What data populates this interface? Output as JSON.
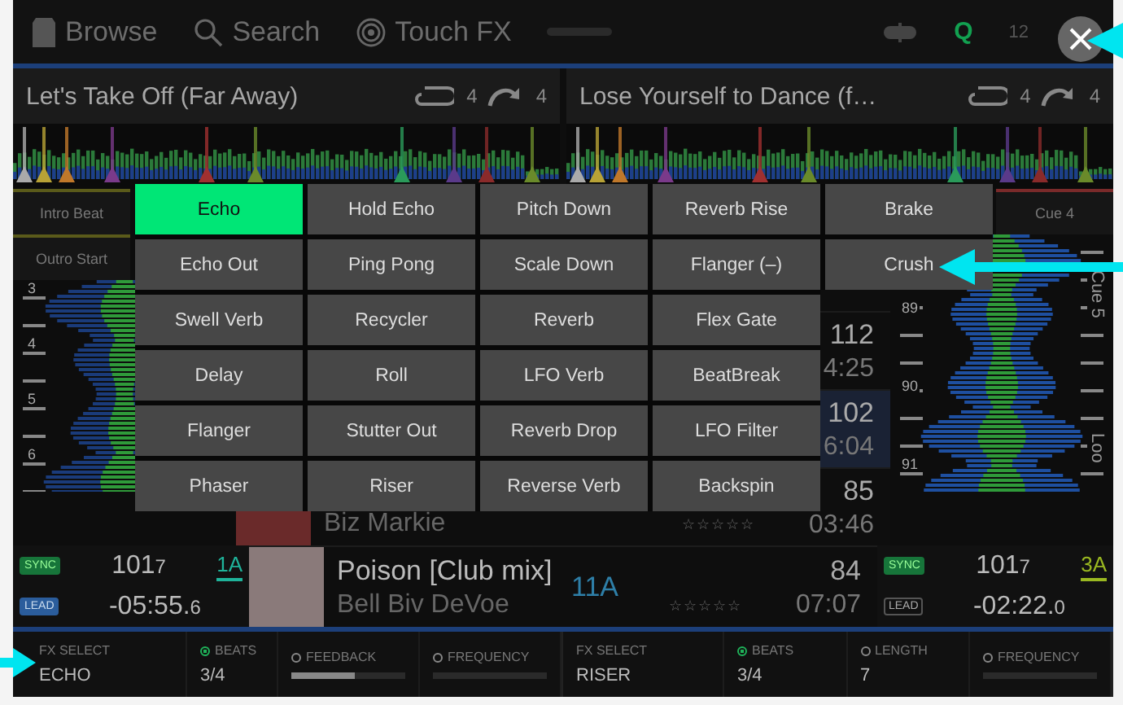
{
  "topbar": {
    "items": [
      {
        "kind": "browse",
        "label": "Browse"
      },
      {
        "kind": "search",
        "label": "Search"
      },
      {
        "kind": "touchfx",
        "label": "Touch FX"
      }
    ],
    "quantize": "Q",
    "clock": "12"
  },
  "decks": [
    {
      "title": "Let's Take Off (Far Away)",
      "loop": "4",
      "jump": "4",
      "cues": [
        "Intro Beat",
        "Outro Start"
      ],
      "beats": [
        "3",
        "4",
        "5",
        "6"
      ],
      "sync": "SYNC",
      "lead": "LEAD",
      "lead_on": true,
      "bpm": "101",
      "bpm_fraction": "7",
      "key": {
        "text": "1A",
        "color": "#1fb39a"
      },
      "time": "-05:55.",
      "time_fraction": "6"
    },
    {
      "title": "Lose Yourself to Dance (f…",
      "loop": "4",
      "jump": "4",
      "cues": [
        "Cue 4"
      ],
      "beats": [
        "89",
        "90",
        "91"
      ],
      "side_labels": [
        "Cue 5",
        "Loo"
      ],
      "sync": "SYNC",
      "lead": "LEAD",
      "lead_on": false,
      "bpm": "101",
      "bpm_fraction": "7",
      "key": {
        "text": "3A",
        "color": "#9ab821"
      },
      "time": "-02:22.",
      "time_fraction": "0"
    }
  ],
  "library": {
    "rows": [
      {
        "bpm": "112",
        "time": "4:25",
        "selected": false
      },
      {
        "bpm": "102",
        "time": "6:04",
        "selected": true
      },
      {
        "artist": "Biz Markie",
        "bpm": "85",
        "time": "03:46",
        "stars": 0,
        "selected": false
      },
      {
        "title": "Poison [Club mix]",
        "artist": "Bell Biv DeVoe",
        "key": "11A",
        "bpm": "84",
        "time": "07:07",
        "stars": 0,
        "selected": false
      }
    ]
  },
  "fx_menu": {
    "rows": [
      [
        {
          "label": "Echo",
          "selected": true
        },
        {
          "label": "Hold Echo",
          "selected": false
        },
        {
          "label": "Pitch Down",
          "selected": false
        },
        {
          "label": "Reverb Rise",
          "selected": false
        },
        {
          "label": "Brake",
          "selected": false
        }
      ],
      [
        {
          "label": "Echo Out",
          "selected": false
        },
        {
          "label": "Ping Pong",
          "selected": false
        },
        {
          "label": "Scale Down",
          "selected": false
        },
        {
          "label": "Flanger (–)",
          "selected": false
        },
        {
          "label": "Crush",
          "selected": false
        }
      ],
      [
        {
          "label": "Swell Verb",
          "selected": false
        },
        {
          "label": "Recycler",
          "selected": false
        },
        {
          "label": "Reverb",
          "selected": false
        },
        {
          "label": "Flex Gate",
          "selected": false
        }
      ],
      [
        {
          "label": "Delay",
          "selected": false
        },
        {
          "label": "Roll",
          "selected": false
        },
        {
          "label": "LFO Verb",
          "selected": false
        },
        {
          "label": "BeatBreak",
          "selected": false
        }
      ],
      [
        {
          "label": "Flanger",
          "selected": false
        },
        {
          "label": "Stutter Out",
          "selected": false
        },
        {
          "label": "Reverb Drop",
          "selected": false
        },
        {
          "label": "LFO Filter",
          "selected": false
        }
      ],
      [
        {
          "label": "Phaser",
          "selected": false
        },
        {
          "label": "Riser",
          "selected": false
        },
        {
          "label": "Reverse Verb",
          "selected": false
        },
        {
          "label": "Backspin",
          "selected": false
        }
      ]
    ]
  },
  "fx_units": [
    {
      "select_label": "FX SELECT",
      "effect": "ECHO",
      "params": [
        {
          "kind": "value",
          "label": "BEATS",
          "selected": true,
          "value": "3/4"
        },
        {
          "kind": "slider",
          "label": "FEEDBACK",
          "selected": false,
          "level": 0.55
        },
        {
          "kind": "slider",
          "label": "FREQUENCY",
          "selected": false,
          "level": 0
        }
      ]
    },
    {
      "select_label": "FX SELECT",
      "effect": "RISER",
      "params": [
        {
          "kind": "value",
          "label": "BEATS",
          "selected": true,
          "value": "3/4"
        },
        {
          "kind": "value",
          "label": "LENGTH",
          "selected": false,
          "value": "7"
        },
        {
          "kind": "slider",
          "label": "FREQUENCY",
          "selected": false,
          "level": 0
        }
      ]
    }
  ]
}
